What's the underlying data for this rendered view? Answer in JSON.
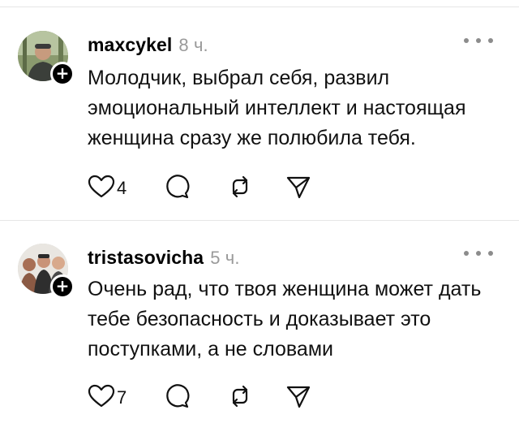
{
  "comments": [
    {
      "username": "maxcykel",
      "time": "8 ч.",
      "text": "Молодчик,  выбрал себя, развил эмоциональный интеллект и настоящая женщина сразу же полюбила тебя.",
      "likes": "4",
      "icons": [
        "heart-icon",
        "comment-icon",
        "repost-icon",
        "share-icon"
      ]
    },
    {
      "username": "tristasovicha",
      "time": "5 ч.",
      "text": "Очень рад, что твоя женщина может дать тебе безопасность и доказывает это поступками, а не словами",
      "likes": "7",
      "icons": [
        "heart-icon",
        "comment-icon",
        "repost-icon",
        "share-icon"
      ]
    }
  ],
  "follow_badge": "+",
  "colors": {
    "text": "#111111",
    "muted": "#9a9a9a",
    "divider": "#e6e6e6",
    "badge": "#000000"
  }
}
